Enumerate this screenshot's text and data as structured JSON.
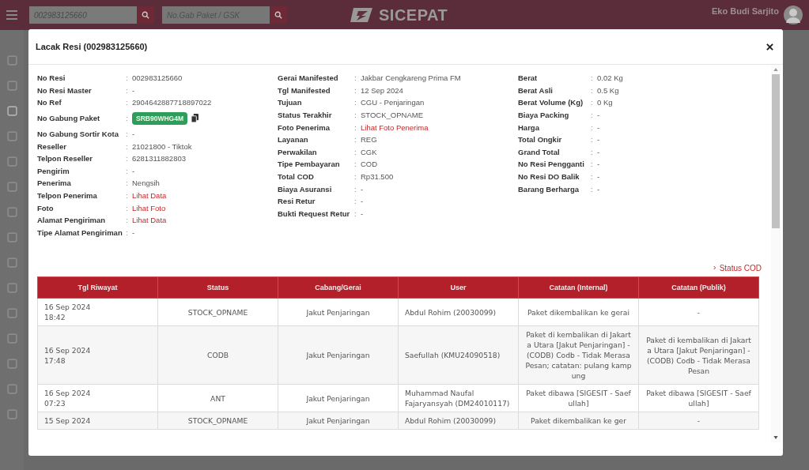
{
  "header": {
    "search_value": "002983125660",
    "gsk_placeholder": "No.Gab Paket / GSK",
    "logo": "SICEPAT",
    "user_name": "Eko Budi Sarjito"
  },
  "modal": {
    "title": "Lacak Resi (002983125660)",
    "info_columns": [
      [
        {
          "label": "No Resi",
          "value": "002983125660",
          "kind": "text"
        },
        {
          "label": "No Resi Master",
          "value": "-",
          "kind": "text"
        },
        {
          "label": "No Ref",
          "value": "2904642887718897022",
          "kind": "text"
        },
        {
          "label": "No Gabung Paket",
          "value": "SRB90WHG4M",
          "kind": "badge"
        },
        {
          "label": "No Gabung Sortir Kota",
          "value": "-",
          "kind": "text"
        },
        {
          "label": "Reseller",
          "value": "21021800 - Tiktok",
          "kind": "text"
        },
        {
          "label": "Telpon Reseller",
          "value": "6281311882803",
          "kind": "text"
        },
        {
          "label": "Pengirim",
          "value": "-",
          "kind": "text"
        },
        {
          "label": "Penerima",
          "value": "Nengsih",
          "kind": "text"
        },
        {
          "label": "Telpon Penerima",
          "value": "Lihat Data",
          "kind": "link"
        },
        {
          "label": "Foto",
          "value": "Lihat Foto",
          "kind": "link"
        },
        {
          "label": "Alamat Pengiriman",
          "value": "Lihat Data",
          "kind": "link"
        },
        {
          "label": "Tipe Alamat Pengiriman",
          "value": "-",
          "kind": "text"
        }
      ],
      [
        {
          "label": "Gerai Manifested",
          "value": "Jakbar Cengkareng Prima FM",
          "kind": "text"
        },
        {
          "label": "Tgl Manifested",
          "value": "12 Sep 2024",
          "kind": "text"
        },
        {
          "label": "Tujuan",
          "value": "CGU - Penjaringan",
          "kind": "text"
        },
        {
          "label": "Status Terakhir",
          "value": "STOCK_OPNAME",
          "kind": "text"
        },
        {
          "label": "Foto Penerima",
          "value": "Lihat Foto Penerima",
          "kind": "link"
        },
        {
          "label": "Layanan",
          "value": "REG",
          "kind": "text"
        },
        {
          "label": "Perwakilan",
          "value": "CGK",
          "kind": "text"
        },
        {
          "label": "Tipe Pembayaran",
          "value": "COD",
          "kind": "text"
        },
        {
          "label": "Total COD",
          "value": "Rp31.500",
          "kind": "text"
        },
        {
          "label": "Biaya Asuransi",
          "value": "-",
          "kind": "text"
        },
        {
          "label": "Resi Retur",
          "value": "-",
          "kind": "text"
        },
        {
          "label": "Bukti Request Retur",
          "value": "-",
          "kind": "text"
        }
      ],
      [
        {
          "label": "Berat",
          "value": "0.02 Kg",
          "kind": "text"
        },
        {
          "label": "Berat Asli",
          "value": "0.5 Kg",
          "kind": "text"
        },
        {
          "label": "Berat Volume (Kg)",
          "value": "0 Kg",
          "kind": "text"
        },
        {
          "label": "Biaya Packing",
          "value": "-",
          "kind": "text"
        },
        {
          "label": "Harga",
          "value": "-",
          "kind": "text"
        },
        {
          "label": "Total Ongkir",
          "value": "-",
          "kind": "text"
        },
        {
          "label": "Grand Total",
          "value": "-",
          "kind": "text"
        },
        {
          "label": "No Resi Pengganti",
          "value": "-",
          "kind": "text"
        },
        {
          "label": "No Resi DO Balik",
          "value": "-",
          "kind": "text"
        },
        {
          "label": "Barang Berharga",
          "value": "-",
          "kind": "text"
        }
      ]
    ],
    "separator": ":",
    "status_cod_link": "Status COD",
    "table": {
      "columns": [
        "Tgl Riwayat",
        "Status",
        "Cabang/Gerai",
        "User",
        "Catatan (Internal)",
        "Catatan (Publik)"
      ],
      "rows": [
        {
          "date": "16 Sep 2024",
          "time": "18:42",
          "status": "STOCK_OPNAME",
          "branch": "Jakut Penjaringan",
          "user": "Abdul Rohim (20030099)",
          "note_internal": "Paket dikembalikan ke gerai",
          "note_public": "-"
        },
        {
          "date": "16 Sep 2024",
          "time": "17:48",
          "status": "CODB",
          "branch": "Jakut Penjaringan",
          "user": "Saefullah (KMU24090518)",
          "note_internal": "Paket di kembalikan di Jakarta Utara [Jakut Penjaringan] - (CODB) Codb - Tidak Merasa Pesan; catatan: pulang kampung",
          "note_public": "Paket di kembalikan di Jakarta Utara [Jakut Penjaringan] - (CODB) Codb - Tidak Merasa Pesan"
        },
        {
          "date": "16 Sep 2024",
          "time": "07:23",
          "status": "ANT",
          "branch": "Jakut Penjaringan",
          "user": "Muhammad Naufal Fajaryansyah (DM24010117)",
          "note_internal": "Paket dibawa [SIGESIT - Saefullah]",
          "note_public": "Paket dibawa [SIGESIT - Saefullah]"
        },
        {
          "date": "15 Sep 2024",
          "status": "STOCK_OPNAME",
          "branch": "Jakut Penjaringan",
          "user": "Abdul Rohim (20030099)",
          "note_internal": "Paket dikembalikan ke ger",
          "note_public": "-"
        }
      ]
    }
  }
}
